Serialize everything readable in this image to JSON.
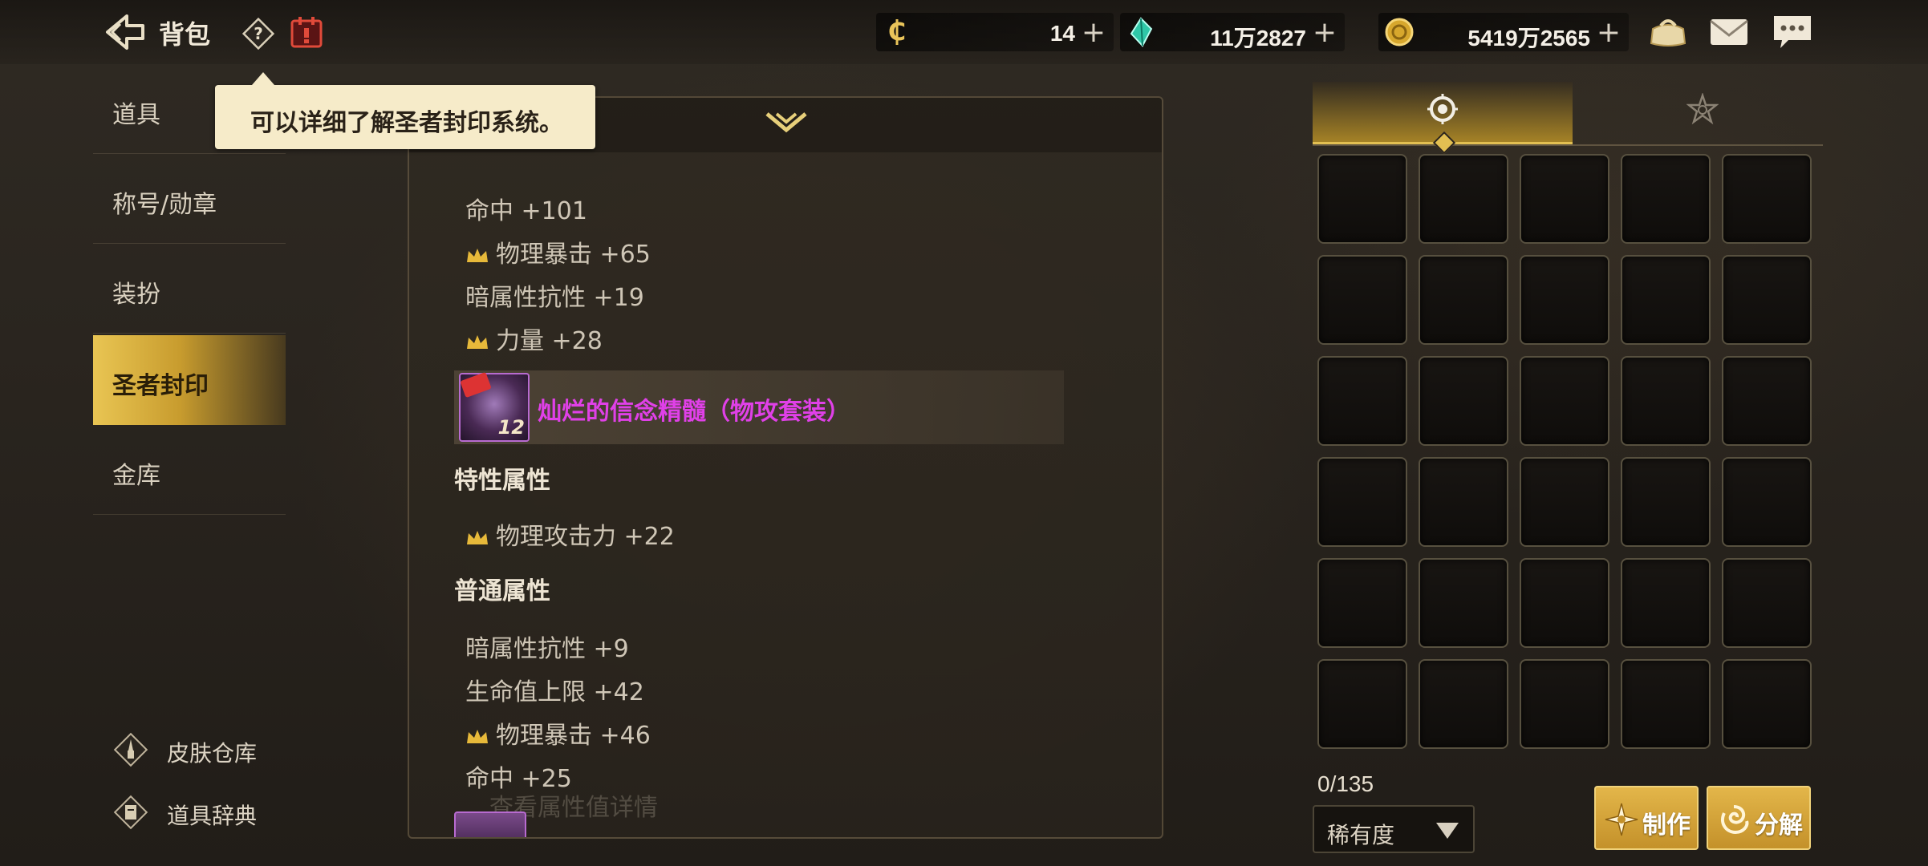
{
  "header": {
    "title": "背包",
    "help_icon": "question-icon",
    "calendar_icon": "calendar-icon"
  },
  "currencies": [
    {
      "icon": "c-coin-icon",
      "value": "14",
      "plus": "+"
    },
    {
      "icon": "gem-icon",
      "value": "11万2827",
      "plus": "+"
    },
    {
      "icon": "gold-coin-icon",
      "value": "5419万2565",
      "plus": "+"
    }
  ],
  "top_icons": [
    "shop-bag-icon",
    "mail-icon",
    "chat-icon"
  ],
  "sidebar": {
    "items": [
      {
        "label": "道具"
      },
      {
        "label": "称号/勋章"
      },
      {
        "label": "装扮"
      },
      {
        "label": "圣者封印"
      },
      {
        "label": "金库"
      }
    ],
    "active_index": 3,
    "links": [
      {
        "label": "皮肤仓库"
      },
      {
        "label": "道具辞典"
      }
    ]
  },
  "tooltip": {
    "text": "可以详细了解圣者封印系统。"
  },
  "details": {
    "top_stats": [
      {
        "text": "命中 +101",
        "crown": false
      },
      {
        "text": "物理暴击 +65",
        "crown": true
      },
      {
        "text": "暗属性抗性 +19",
        "crown": false
      },
      {
        "text": "力量 +28",
        "crown": true
      }
    ],
    "set_item": {
      "name": "灿烂的信念精髓（物攻套装）",
      "level": "12"
    },
    "trait_title": "特性属性",
    "trait_stats": [
      {
        "text": "物理攻击力 +22",
        "crown": true
      }
    ],
    "normal_title": "普通属性",
    "normal_stats": [
      {
        "text": "暗属性抗性 +9",
        "crown": false
      },
      {
        "text": "生命值上限 +42",
        "crown": false
      },
      {
        "text": "物理暴击 +46",
        "crown": true
      },
      {
        "text": "命中 +25",
        "crown": false
      }
    ],
    "faded_link": "查看属性值详情"
  },
  "inventory": {
    "tabs": [
      "seal-tab-icon",
      "star-tab-icon"
    ],
    "active_tab": 0,
    "count": "0/135",
    "sort_label": "稀有度",
    "craft_label": "制作",
    "dismantle_label": "分解"
  },
  "colors": {
    "accent_gold": "#e2bf52",
    "set_name": "#e040e8",
    "tooltip_bg": "#f6ebc9"
  }
}
